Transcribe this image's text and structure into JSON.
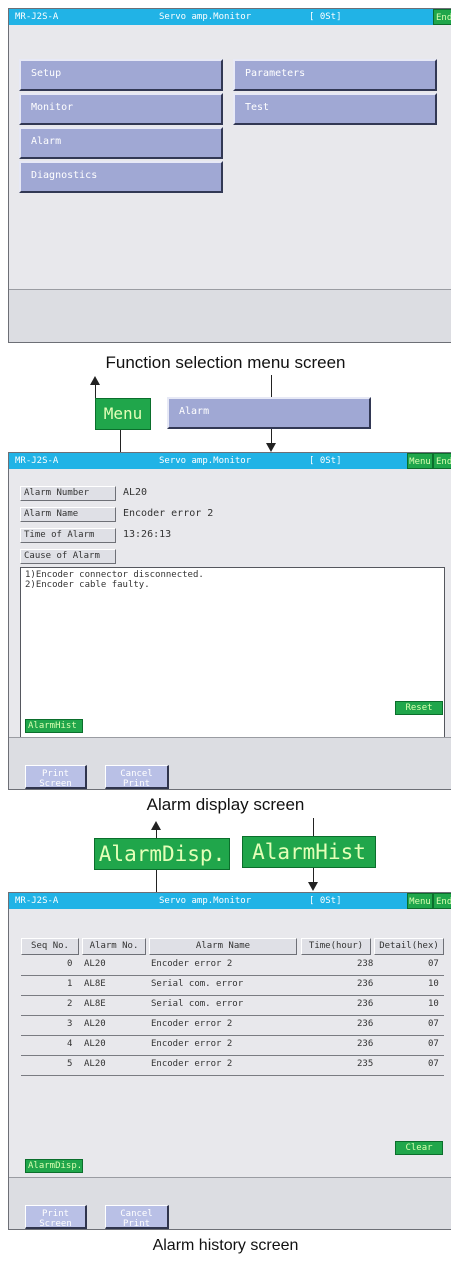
{
  "colors": {
    "title_bar": "#21b3e6",
    "green_button": "#20a64b",
    "menu_button": "#a0a8d4",
    "screen_bg": "#e8e8ec"
  },
  "menu_screen": {
    "title": {
      "model": "MR-J2S-A",
      "name": "Servo amp.Monitor",
      "station": "[ 0St]",
      "end": "End"
    },
    "left_items": [
      "Setup",
      "Monitor",
      "Alarm",
      "Diagnostics"
    ],
    "right_items": [
      "Parameters",
      "Test"
    ],
    "caption": "Function selection menu screen"
  },
  "nav1": {
    "menu_label": "Menu",
    "alarm_label": "Alarm"
  },
  "alarm_screen": {
    "title": {
      "model": "MR-J2S-A",
      "name": "Servo amp.Monitor",
      "station": "[ 0St]",
      "menu": "Menu",
      "end": "End"
    },
    "number_label": "Alarm Number",
    "number_value": "AL20",
    "name_label": "Alarm Name",
    "name_value": "Encoder error 2",
    "time_label": "Time of Alarm",
    "time_value": "13:26:13",
    "cause_label": "Cause of Alarm",
    "cause_text": "1)Encoder connector disconnected.\n2)Encoder cable faulty.",
    "reset": "Reset",
    "alarm_hist": "AlarmHist",
    "print_screen": [
      "Print",
      "Screen"
    ],
    "cancel_print": [
      "Cancel",
      "Print"
    ],
    "caption": "Alarm display screen"
  },
  "nav2": {
    "alarm_disp": "AlarmDisp.",
    "alarm_hist": "AlarmHist"
  },
  "history_screen": {
    "title": {
      "model": "MR-J2S-A",
      "name": "Servo amp.Monitor",
      "station": "[ 0St]",
      "menu": "Menu",
      "end": "End"
    },
    "headers": [
      "Seq No.",
      "Alarm No.",
      "Alarm Name",
      "Time(hour)",
      "Detail(hex)"
    ],
    "rows": [
      {
        "seq": "0",
        "no": "AL20",
        "name": "Encoder error 2",
        "time": "238",
        "detail": "07"
      },
      {
        "seq": "1",
        "no": "AL8E",
        "name": "Serial com. error",
        "time": "236",
        "detail": "10"
      },
      {
        "seq": "2",
        "no": "AL8E",
        "name": "Serial com. error",
        "time": "236",
        "detail": "10"
      },
      {
        "seq": "3",
        "no": "AL20",
        "name": "Encoder error 2",
        "time": "236",
        "detail": "07"
      },
      {
        "seq": "4",
        "no": "AL20",
        "name": "Encoder error 2",
        "time": "236",
        "detail": "07"
      },
      {
        "seq": "5",
        "no": "AL20",
        "name": "Encoder error 2",
        "time": "235",
        "detail": "07"
      }
    ],
    "clear": "Clear",
    "alarm_disp": "AlarmDisp.",
    "print_screen": [
      "Print",
      "Screen"
    ],
    "cancel_print": [
      "Cancel",
      "Print"
    ],
    "caption": "Alarm history screen"
  }
}
